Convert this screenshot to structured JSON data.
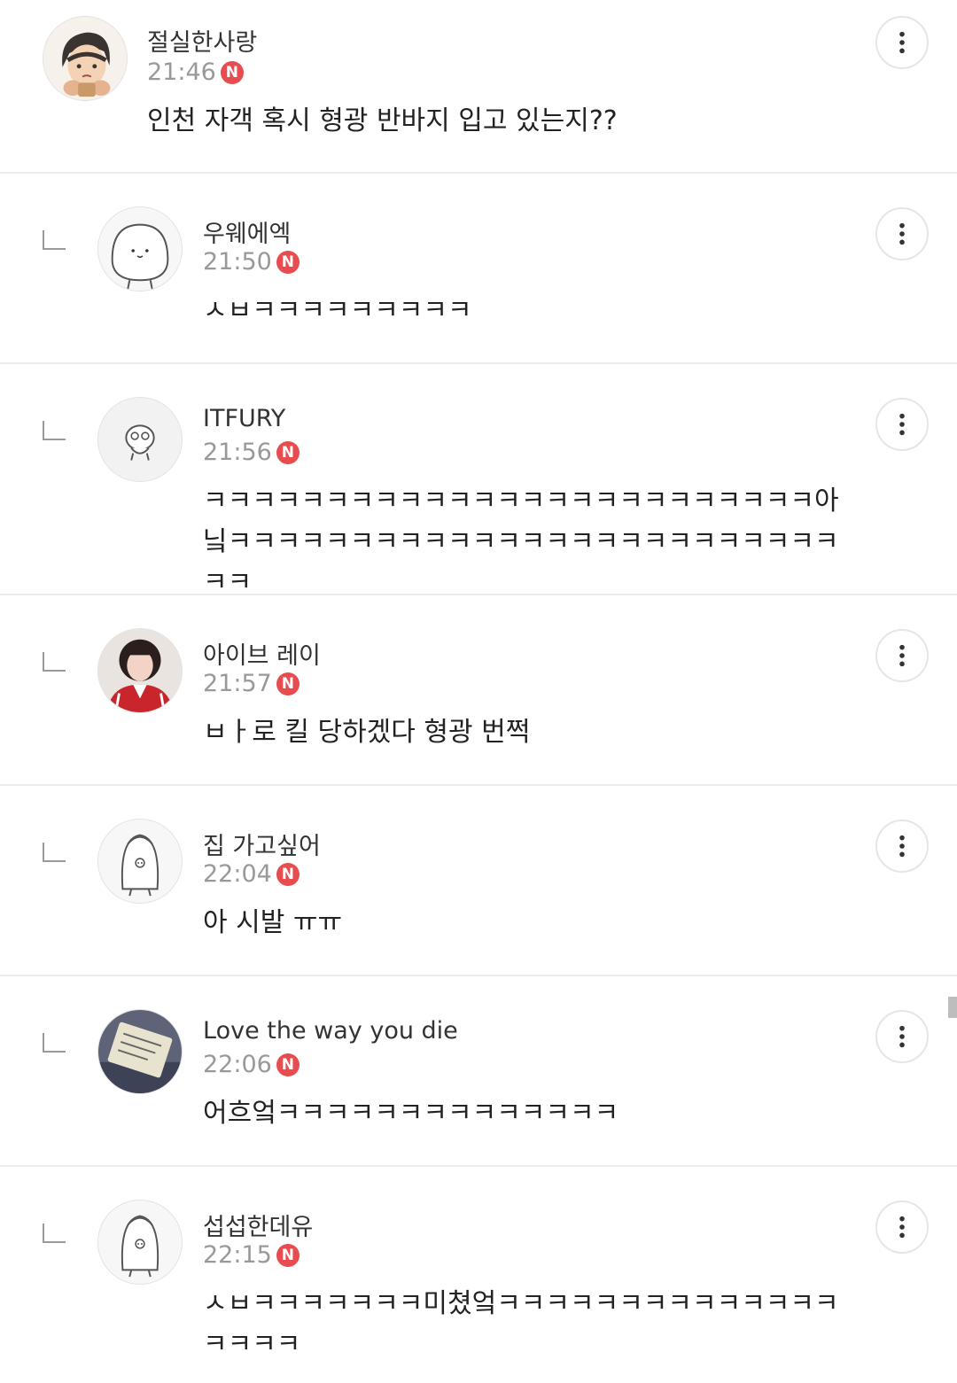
{
  "comments": [
    {
      "author": "절실한사랑",
      "time": "21:46",
      "badge": "N",
      "text": "인천 자객 혹시 형광 반바지 입고 있는지??",
      "avatar_icon": "cartoon-face-avatar"
    },
    {
      "author": "우웨에엑",
      "time": "21:50",
      "badge": "N",
      "text": "ㅅㅂㅋㅋㅋㅋㅋㅋㅋㅋㅋ",
      "avatar_icon": "round-blob-character-avatar"
    },
    {
      "author": "ITFURY",
      "time": "21:56",
      "badge": "N",
      "text": "ㅋㅋㅋㅋㅋㅋㅋㅋㅋㅋㅋㅋㅋㅋㅋㅋㅋㅋㅋㅋㅋㅋㅋㅋㅋ아닠ㅋㅋㅋㅋㅋㅋㅋㅋㅋㅋㅋㅋㅋㅋㅋㅋㅋㅋㅋㅋㅋㅋㅋㅋㅋㅋㅋ",
      "avatar_icon": "small-character-avatar"
    },
    {
      "author": "아이브 레이",
      "time": "21:57",
      "badge": "N",
      "text": "ㅂㅏ로 킬 당하겠다 형광 번쩍",
      "avatar_icon": "photo-portrait-avatar"
    },
    {
      "author": "집 가고싶어",
      "time": "22:04",
      "badge": "N",
      "text": "아 시발 ㅠㅠ",
      "avatar_icon": "penguin-character-avatar"
    },
    {
      "author": "Love the way you die",
      "time": "22:06",
      "badge": "N",
      "text": "어흐엌ㅋㅋㅋㅋㅋㅋㅋㅋㅋㅋㅋㅋㅋㅋ",
      "avatar_icon": "note-photo-avatar"
    },
    {
      "author": "섭섭한데유",
      "time": "22:15",
      "badge": "N",
      "text": "ㅅㅂㅋㅋㅋㅋㅋㅋㅋ미쳤엌ㅋㅋㅋㅋㅋㅋㅋㅋㅋㅋㅋㅋㅋㅋㅋㅋㅋㅋ",
      "avatar_icon": "penguin-character-avatar"
    }
  ],
  "colors": {
    "badge": "#e84c4f",
    "divider": "#ebebeb",
    "time": "#999999",
    "text": "#222222"
  }
}
